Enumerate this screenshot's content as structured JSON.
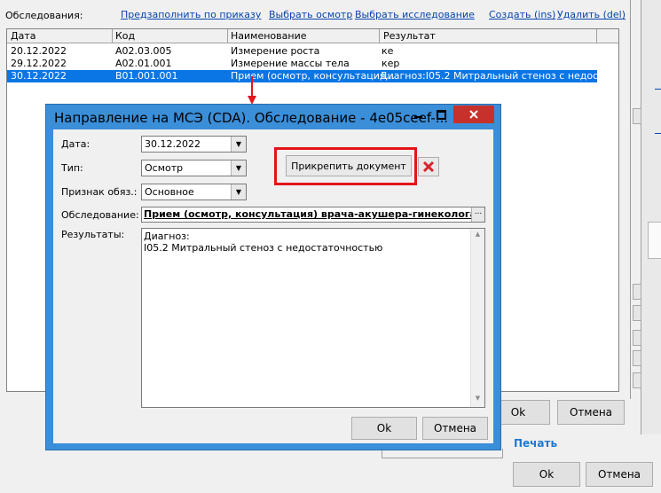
{
  "toolbar": {
    "label": "Обследования:",
    "prefill_link": "Предзаполнить по приказу",
    "select_exam_link": "Выбрать осмотр",
    "select_study_link": "Выбрать исследование",
    "create_link": "Создать (ins)",
    "delete_link": "Удалить (del)"
  },
  "table": {
    "columns": [
      "Дата",
      "Код",
      "Наименование",
      "Результат"
    ],
    "rows": [
      {
        "date": "20.12.2022",
        "code": "A02.03.005",
        "name": "Измерение роста",
        "result": "ке"
      },
      {
        "date": "29.12.2022",
        "code": "A02.01.001",
        "name": "Измерение массы тела",
        "result": "кер"
      },
      {
        "date": "30.12.2022",
        "code": "B01.001.001",
        "name": "Прием (осмотр, консультация...",
        "result": "Диагноз:I05.2 Митральный стеноз с недост..."
      }
    ]
  },
  "colors": {
    "title_bar": "#3b8ed8",
    "selection": "#0a76e6",
    "highlight_box": "#e5141b",
    "arrow": "#e5141b",
    "print_link": "#1e78d2"
  },
  "background": {
    "ok_1": "Ok",
    "cancel_1": "Отмена",
    "print_link": "Печать",
    "ok_2": "Ok",
    "cancel_2": "Отмена"
  },
  "dialog": {
    "title": "Направление на МСЭ (CDA). Обследование - 4e05ceef-...",
    "date_label": "Дата:",
    "date_value": "30.12.2022",
    "type_label": "Тип:",
    "type_value": "Осмотр",
    "mandatory_label": "Признак обяз.:",
    "mandatory_value": "Основное",
    "attach_button": "Прикрепить документ",
    "exam_label": "Обследование:",
    "exam_value": "Прием (осмотр, консультация) врача-акушера-гинеколога пер",
    "exam_browse": "...",
    "results_label": "Результаты:",
    "results_line1": "Диагноз:",
    "results_line2": "I05.2 Митральный стеноз с недостаточностью",
    "ok_button": "Ok",
    "cancel_button": "Отмена"
  }
}
